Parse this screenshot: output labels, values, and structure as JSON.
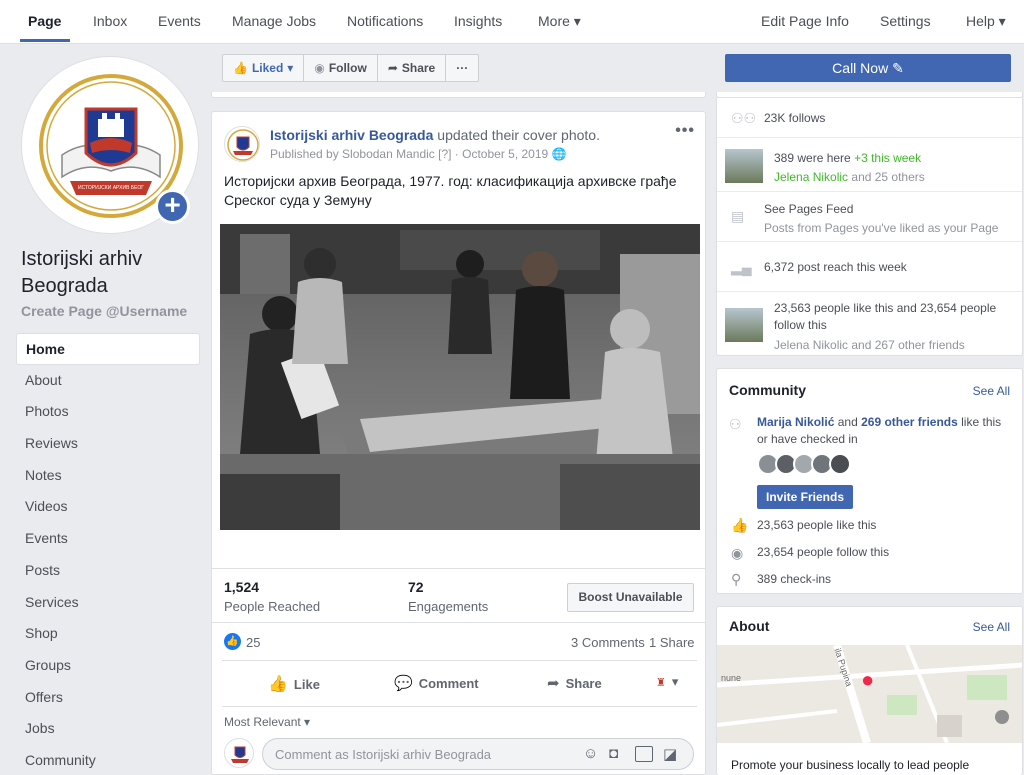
{
  "nav": {
    "tabs": [
      "Page",
      "Inbox",
      "Events",
      "Manage Jobs",
      "Notifications",
      "Insights",
      "More ▾"
    ],
    "right": [
      "Edit Page Info",
      "Settings",
      "Help ▾"
    ]
  },
  "page": {
    "name": "Istorijski arhiv Beograda",
    "username": "Create Page @Username",
    "logo_text": "ИСТОРИЈСКИ АРХИВ БЕОГРАДА"
  },
  "left_nav": [
    "Home",
    "About",
    "Photos",
    "Reviews",
    "Notes",
    "Videos",
    "Events",
    "Posts",
    "Services",
    "Shop",
    "Groups",
    "Offers",
    "Jobs",
    "Community"
  ],
  "actions": {
    "liked": "Liked",
    "follow": "Follow",
    "share": "Share",
    "more": "···",
    "call_now": "Call Now"
  },
  "post": {
    "author": "Istorijski arhiv Beograda",
    "action_text": "updated their cover photo.",
    "published_by": "Published by Slobodan Mandic",
    "published_marker": "[?]",
    "date": "October 5, 2019",
    "text": "Историјски архив Београда, 1977. год: класификација архивске грађе Среског суда у Земуну",
    "people_reached": "1,524",
    "people_reached_label": "People Reached",
    "engagements": "72",
    "engagements_label": "Engagements",
    "boost": "Boost Unavailable",
    "reactions": "25",
    "comments": "3 Comments",
    "shares": "1 Share",
    "like": "Like",
    "comment": "Comment",
    "share": "Share",
    "sort": "Most Relevant ▾",
    "comment_placeholder": "Comment as Istorijski arhiv Beograda"
  },
  "sidebar": {
    "follows": "23K follows",
    "were_here": "389 were here",
    "this_week": "+3 this week",
    "were_here_friends": "Jelena Nikolic",
    "were_here_others": "and 25 others",
    "pages_feed": "See Pages Feed",
    "pages_feed_sub": "Posts from Pages you've liked as your Page",
    "reach": "6,372 post reach this week",
    "likes_follows": "23,563 people like this and 23,654 people follow this",
    "likes_friends": "Jelena Nikolic and 267 other friends",
    "community_title": "Community",
    "see_all": "See All",
    "community_friend": "Marija Nikolić",
    "community_and": "and",
    "community_others": "269 other friends",
    "community_rest": "like this or have checked in",
    "invite": "Invite Friends",
    "like_count": "23,563 people like this",
    "follow_count": "23,654 people follow this",
    "checkins": "389 check-ins",
    "about_title": "About",
    "promote": "Promote your business locally to lead people",
    "map_street": "ila Pupina",
    "map_street2": "nune"
  },
  "colors": {
    "brand": "#4267b2",
    "link": "#385898",
    "background": "#e9ebee",
    "green": "#42b72a"
  }
}
